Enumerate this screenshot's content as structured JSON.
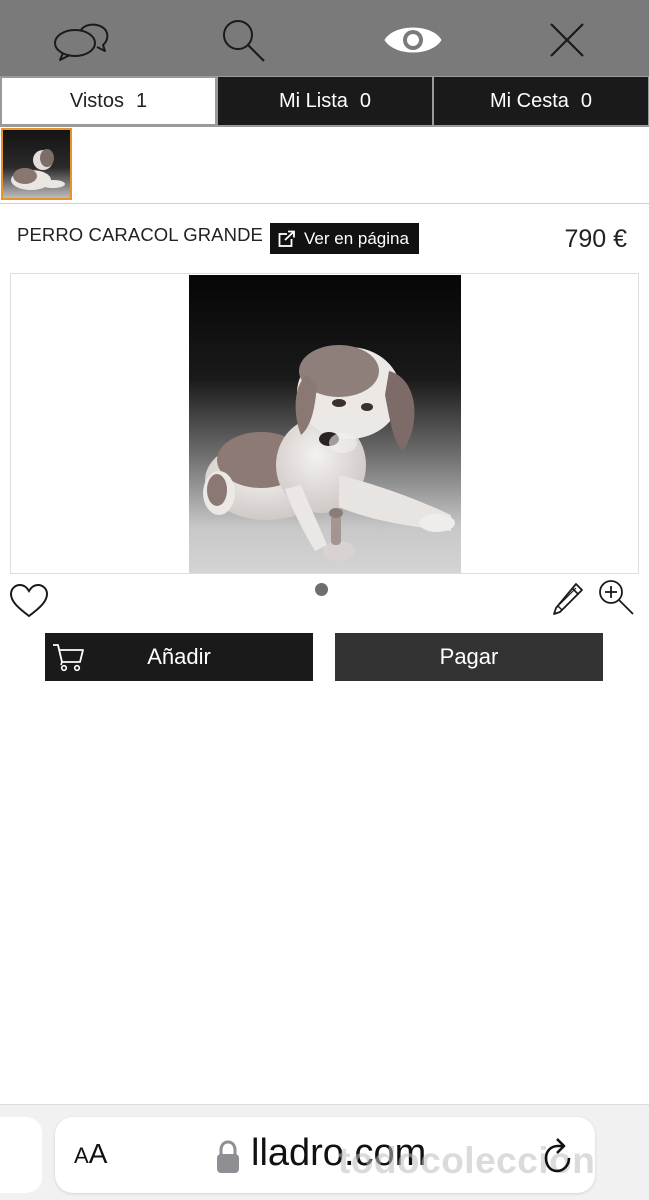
{
  "topbar": {
    "icons": [
      "chat-icon",
      "search-icon",
      "eye-icon",
      "close-icon"
    ],
    "background": "#7a7a7a"
  },
  "tabs": [
    {
      "label": "Vistos",
      "count": "1",
      "active": true
    },
    {
      "label": "Mi Lista",
      "count": "0",
      "active": false
    },
    {
      "label": "Mi Cesta",
      "count": "0",
      "active": false
    }
  ],
  "thumbnails": {
    "highlight_color": "#e8922a"
  },
  "product": {
    "title": "PERRO CARACOL GRANDE",
    "view_link_label": "Ver en página",
    "price": "790 €"
  },
  "carousel": {
    "current": 1,
    "total": 1
  },
  "actions": {
    "add_label": "Añadir",
    "pay_label": "Pagar"
  },
  "browser": {
    "text_size_label_small": "A",
    "text_size_label_large": "A",
    "url": "lladro.com",
    "watermark": "todocoleccion"
  }
}
